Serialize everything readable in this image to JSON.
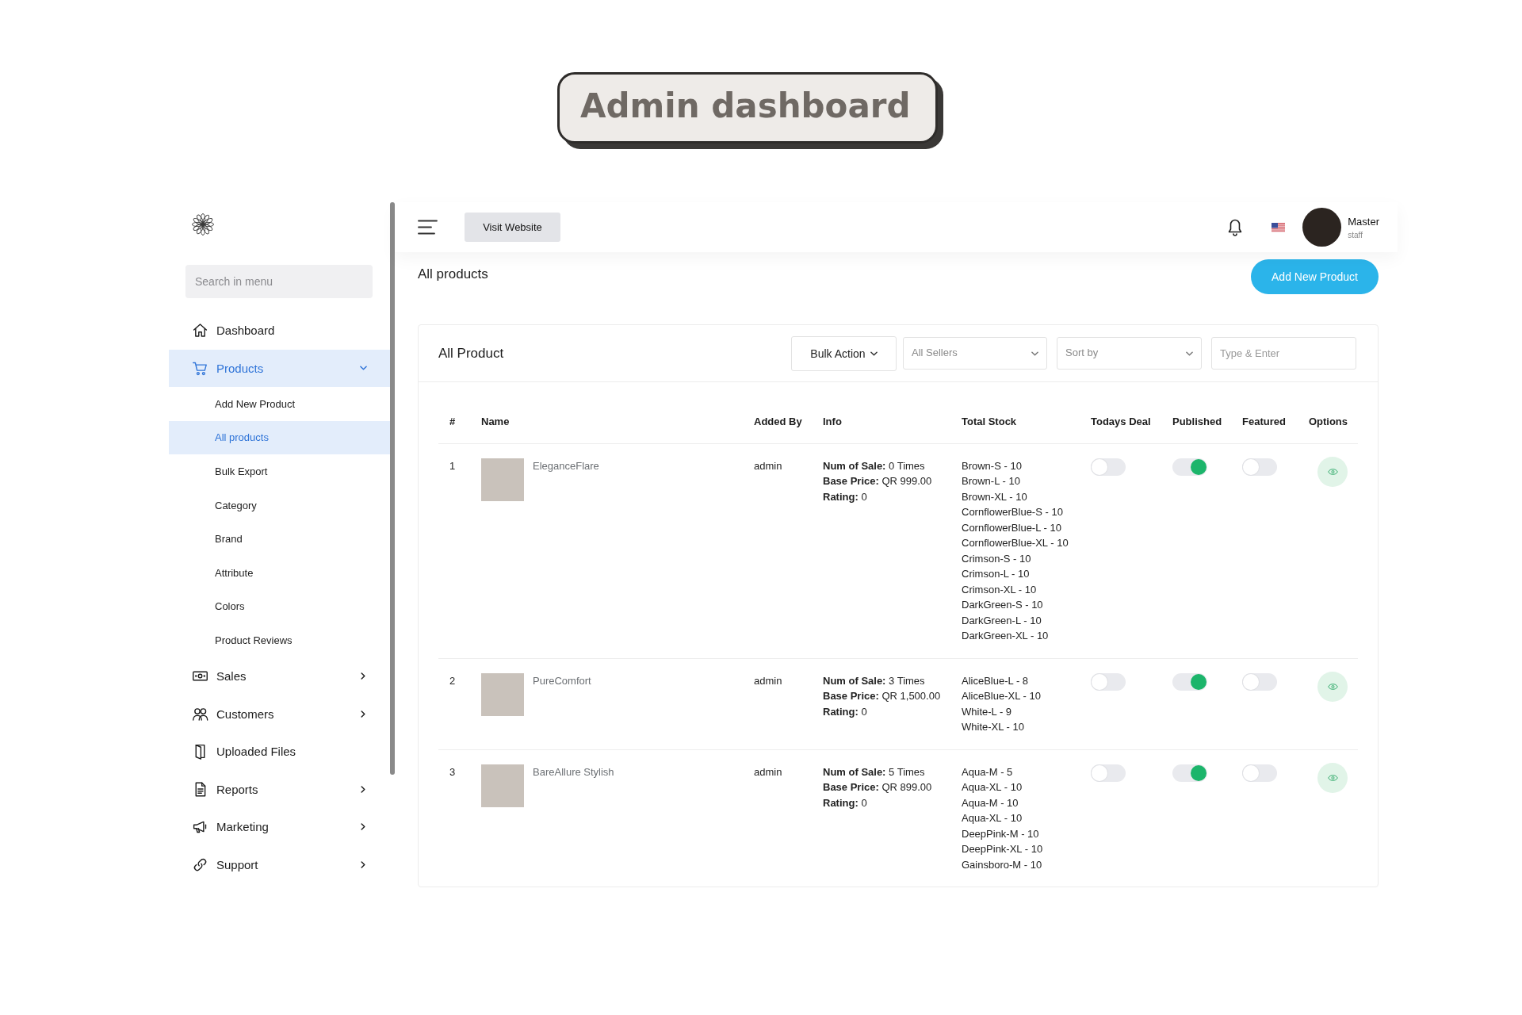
{
  "banner": {
    "title": "Admin dashboard"
  },
  "sidebar": {
    "search": {
      "placeholder": "Search in menu"
    },
    "items": [
      {
        "label": "Dashboard",
        "kind": "link",
        "selected": false
      },
      {
        "label": "Products",
        "kind": "group",
        "selected": true,
        "expanded": true,
        "children": [
          {
            "label": "Add New Product",
            "selected": false
          },
          {
            "label": "All products",
            "selected": true
          },
          {
            "label": "Bulk Export",
            "selected": false
          },
          {
            "label": "Category",
            "selected": false
          },
          {
            "label": "Brand",
            "selected": false
          },
          {
            "label": "Attribute",
            "selected": false
          },
          {
            "label": "Colors",
            "selected": false
          },
          {
            "label": "Product Reviews",
            "selected": false
          }
        ]
      },
      {
        "label": "Sales",
        "kind": "group",
        "selected": false,
        "expanded": false
      },
      {
        "label": "Customers",
        "kind": "group",
        "selected": false,
        "expanded": false
      },
      {
        "label": "Uploaded Files",
        "kind": "link",
        "selected": false
      },
      {
        "label": "Reports",
        "kind": "group",
        "selected": false,
        "expanded": false
      },
      {
        "label": "Marketing",
        "kind": "group",
        "selected": false,
        "expanded": false
      },
      {
        "label": "Support",
        "kind": "group",
        "selected": false,
        "expanded": false
      }
    ]
  },
  "top_bar": {
    "visit_button": "Visit Website",
    "user": {
      "name": "Master",
      "role": "staff"
    }
  },
  "page": {
    "title": "All products",
    "add_button": "Add New Product"
  },
  "product_card": {
    "title": "All Product",
    "bulk_action": "Bulk Action",
    "seller_filter": "All Sellers",
    "sort_filter": "Sort by",
    "search": {
      "placeholder": "Type & Enter"
    },
    "table": {
      "columns": [
        "#",
        "Name",
        "Added By",
        "Info",
        "Total Stock",
        "Todays Deal",
        "Published",
        "Featured",
        "Options"
      ],
      "rows": [
        {
          "number": "1",
          "name": "EleganceFlare",
          "added_by": "admin",
          "info": [
            "**Num of Sale:** 0 Times",
            "**Base Price:** QR 999.00",
            "**Rating:** 0"
          ],
          "stock": [
            "Brown-S - 10",
            "Brown-L - 10",
            "Brown-XL - 10",
            "CornflowerBlue-S - 10",
            "CornflowerBlue-L - 10",
            "CornflowerBlue-XL - 10",
            "Crimson-S - 10",
            "Crimson-L - 10",
            "Crimson-XL - 10",
            "DarkGreen-S - 10",
            "DarkGreen-L - 10",
            "DarkGreen-XL - 10"
          ],
          "todays_deal": false,
          "published": true,
          "featured": false
        },
        {
          "number": "2",
          "name": "PureComfort",
          "added_by": "admin",
          "info": [
            "**Num of Sale:** 3 Times",
            "**Base Price:** QR 1,500.00",
            "**Rating:** 0"
          ],
          "stock": [
            "AliceBlue-L - 8",
            "AliceBlue-XL - 10",
            "White-L - 9",
            "White-XL - 10"
          ],
          "todays_deal": false,
          "published": true,
          "featured": false
        },
        {
          "number": "3",
          "name": "BareAllure Stylish",
          "added_by": "admin",
          "info": [
            "**Num of Sale:** 5 Times",
            "**Base Price:** QR 899.00",
            "**Rating:** 0"
          ],
          "stock": [
            "Aqua-M - 5",
            "Aqua-XL - 10",
            "Aqua-M - 10",
            "Aqua-XL - 10",
            "DeepPink-M - 10",
            "DeepPink-XL - 10",
            "Gainsboro-M - 10"
          ],
          "todays_deal": false,
          "published": true,
          "featured": false
        }
      ]
    }
  }
}
